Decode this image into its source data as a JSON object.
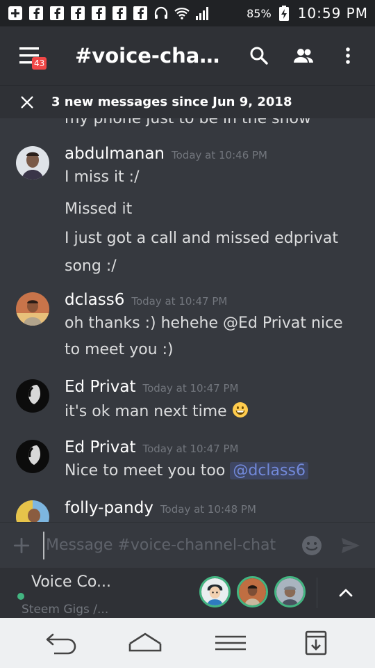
{
  "status_bar": {
    "battery_percent": "85%",
    "time": "10:59 PM",
    "icons": [
      "plus-box-icon",
      "facebook-icon",
      "facebook-icon",
      "facebook-icon",
      "facebook-icon",
      "facebook-icon",
      "facebook-icon",
      "headset-icon",
      "wifi-icon",
      "signal-icon",
      "battery-charging-icon"
    ]
  },
  "app_bar": {
    "menu_badge": "43",
    "channel_title": "#voice-channel-chat",
    "actions": [
      "search-icon",
      "members-icon",
      "more-vertical-icon"
    ]
  },
  "banner": {
    "text": "3 new messages since Jun 9, 2018"
  },
  "messages": {
    "clipped_top_line": "my phone just to be in the show",
    "groups": [
      {
        "author": "abdulmanan",
        "timestamp": "Today at 10:46 PM",
        "lines": [
          "I miss it :/",
          "Missed it",
          "I just got a call and missed edprivat",
          "song :/"
        ]
      },
      {
        "author": "dclass6",
        "timestamp": "Today at 10:47 PM",
        "lines": [
          "oh thanks :) hehehe @Ed Privat nice",
          "to meet you :)"
        ]
      },
      {
        "author": "Ed Privat",
        "timestamp": "Today at 10:47 PM",
        "lines": [
          "it's ok man next time"
        ],
        "emoji": "grinning-face-emoji"
      },
      {
        "author": "Ed Privat",
        "timestamp": "Today at 10:47 PM",
        "lines": [
          "Nice to meet you too "
        ],
        "mention": "@dclass6"
      },
      {
        "author": "folly-pandy",
        "timestamp": "Today at 10:48 PM",
        "lines": []
      }
    ]
  },
  "composer": {
    "placeholder": "Message #voice-channel-chat"
  },
  "voice_bar": {
    "title": "Voice Co...",
    "subtitle": "Steem Gigs /...",
    "status_color": "#43b581",
    "participants": 3
  },
  "colors": {
    "background": "#36393f",
    "header": "#2f3136",
    "status_bar": "#202225",
    "mention_text": "#7289da",
    "timestamp": "#72767d",
    "badge": "#f04747"
  }
}
